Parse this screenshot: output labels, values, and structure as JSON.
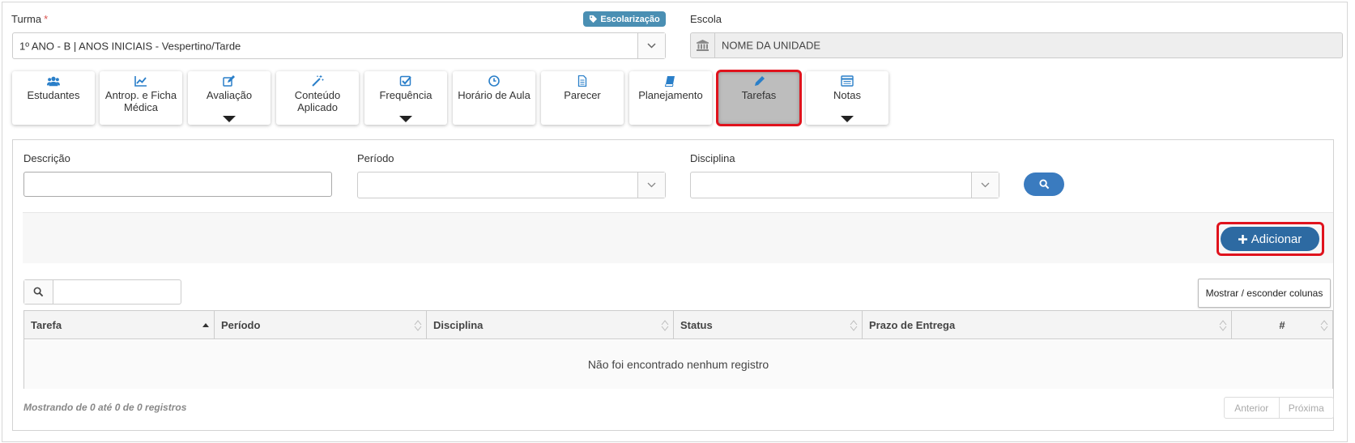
{
  "turma": {
    "label": "Turma",
    "required_mark": "*",
    "badge": "Escolarização",
    "value": "1º ANO - B | ANOS INICIAIS - Vespertino/Tarde"
  },
  "escola": {
    "label": "Escola",
    "value": "NOME DA UNIDADE"
  },
  "tiles": [
    {
      "label": "Estudantes",
      "icon": "users-icon"
    },
    {
      "label": "Antrop. e Ficha Médica",
      "icon": "chart-line-icon"
    },
    {
      "label": "Avaliação",
      "icon": "edit-icon",
      "dropdown": true
    },
    {
      "label": "Conteúdo Aplicado",
      "icon": "magic-wand-icon"
    },
    {
      "label": "Frequência",
      "icon": "check-square-icon",
      "dropdown": true
    },
    {
      "label": "Horário de Aula",
      "icon": "clock-icon"
    },
    {
      "label": "Parecer",
      "icon": "document-icon"
    },
    {
      "label": "Planejamento",
      "icon": "book-icon"
    },
    {
      "label": "Tarefas",
      "icon": "pencil-icon",
      "active": true
    },
    {
      "label": "Notas",
      "icon": "list-icon",
      "dropdown": true
    }
  ],
  "filters": {
    "descricao_label": "Descrição",
    "periodo_label": "Período",
    "disciplina_label": "Disciplina"
  },
  "actions": {
    "add_label": "Adicionar",
    "columns_label": "Mostrar / esconder colunas"
  },
  "table": {
    "columns": [
      "Tarefa",
      "Período",
      "Disciplina",
      "Status",
      "Prazo de Entrega",
      "#"
    ],
    "empty_message": "Não foi encontrado nenhum registro"
  },
  "footer": {
    "info": "Mostrando de 0 até 0 de 0 registros",
    "prev": "Anterior",
    "next": "Próxima"
  },
  "colors": {
    "primary": "#2d6aa2",
    "search_button": "#3a7bbf",
    "icon_blue": "#2a7fc9",
    "highlight": "#e0131d",
    "badge": "#4a8fb3"
  }
}
